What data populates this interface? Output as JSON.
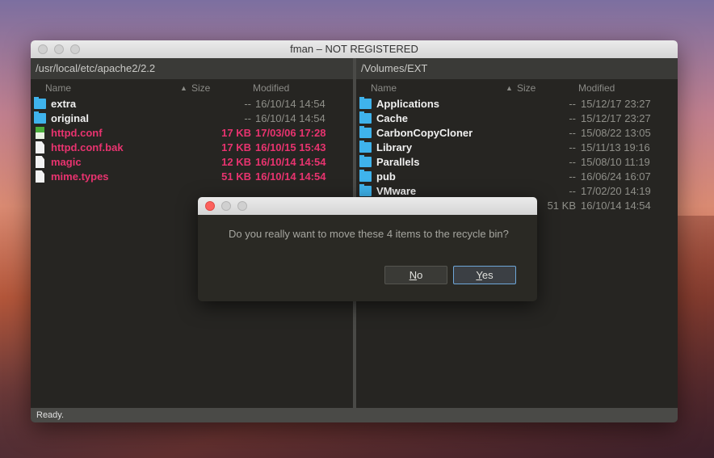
{
  "window": {
    "title": "fman – NOT REGISTERED",
    "status": "Ready."
  },
  "columns": {
    "name": "Name",
    "size": "Size",
    "modified": "Modified",
    "sort_icon": "▲"
  },
  "left": {
    "path": "/usr/local/etc/apache2/2.2",
    "rows": [
      {
        "icon": "folder",
        "name": "extra",
        "size": "--",
        "modified": "16/10/14 14:54",
        "selected": false
      },
      {
        "icon": "folder",
        "name": "original",
        "size": "--",
        "modified": "16/10/14 14:54",
        "selected": false
      },
      {
        "icon": "config-file",
        "name": "httpd.conf",
        "size": "17 KB",
        "modified": "17/03/06 17:28",
        "selected": true
      },
      {
        "icon": "file",
        "name": "httpd.conf.bak",
        "size": "17 KB",
        "modified": "16/10/15 15:43",
        "selected": true
      },
      {
        "icon": "file",
        "name": "magic",
        "size": "12 KB",
        "modified": "16/10/14 14:54",
        "selected": true
      },
      {
        "icon": "file",
        "name": "mime.types",
        "size": "51 KB",
        "modified": "16/10/14 14:54",
        "selected": true
      }
    ]
  },
  "right": {
    "path": "/Volumes/EXT",
    "rows": [
      {
        "icon": "folder",
        "name": "Applications",
        "size": "--",
        "modified": "15/12/17 23:27"
      },
      {
        "icon": "folder",
        "name": "Cache",
        "size": "--",
        "modified": "15/12/17 23:27"
      },
      {
        "icon": "folder",
        "name": "CarbonCopyCloner",
        "size": "--",
        "modified": "15/08/22 13:05"
      },
      {
        "icon": "folder",
        "name": "Library",
        "size": "--",
        "modified": "15/11/13 19:16"
      },
      {
        "icon": "folder",
        "name": "Parallels",
        "size": "--",
        "modified": "15/08/10 11:19"
      },
      {
        "icon": "folder",
        "name": "pub",
        "size": "--",
        "modified": "16/06/24 16:07"
      },
      {
        "icon": "folder",
        "name": "VMware",
        "size": "--",
        "modified": "17/02/20 14:19"
      },
      {
        "icon": "file",
        "name": "",
        "size": "51 KB",
        "modified": "16/10/14 14:54"
      }
    ]
  },
  "dialog": {
    "message": "Do you really want to move these 4 items to the recycle bin?",
    "no": {
      "mnemonic": "N",
      "rest": "o"
    },
    "yes": {
      "mnemonic": "Y",
      "rest": "es"
    }
  },
  "colors": {
    "selected": "#e8336f",
    "folder": "#3fb3ec",
    "accent": "#6ea6d8"
  }
}
